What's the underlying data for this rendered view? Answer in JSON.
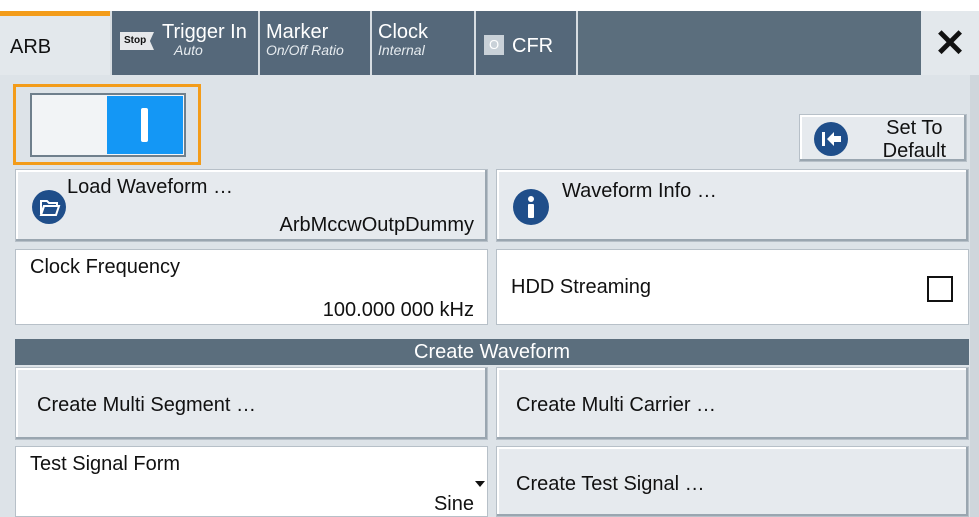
{
  "tabs": [
    {
      "label": "ARB",
      "sub": "",
      "badge": ""
    },
    {
      "label": "Trigger In",
      "sub": "Auto",
      "badge": "Stop"
    },
    {
      "label": "Marker",
      "sub": "On/Off Ratio",
      "badge": ""
    },
    {
      "label": "Clock",
      "sub": "Internal",
      "badge": ""
    },
    {
      "label": "CFR",
      "sub": "",
      "badge": "O"
    }
  ],
  "close_label": "✕",
  "state_toggle": {
    "on": true
  },
  "set_to_default": {
    "line1": "Set To",
    "line2": "Default"
  },
  "load_waveform": {
    "label": "Load Waveform …",
    "value": "ArbMccwOutpDummy"
  },
  "waveform_info": {
    "label": "Waveform Info …"
  },
  "clock_frequency": {
    "label": "Clock Frequency",
    "value": "100.000 000 kHz"
  },
  "hdd_streaming": {
    "label": "HDD Streaming",
    "checked": false
  },
  "create_waveform_header": "Create Waveform",
  "create_multi_segment": "Create Multi Segment …",
  "create_multi_carrier": "Create Multi Carrier …",
  "test_signal_form": {
    "label": "Test Signal Form",
    "value": "Sine"
  },
  "create_test_signal": "Create Test Signal …",
  "colors": {
    "accent": "#f39c1a",
    "toggle_on": "#1497f5",
    "tabbar": "#5b6e7d",
    "icon_blue": "#1f4e8a"
  }
}
